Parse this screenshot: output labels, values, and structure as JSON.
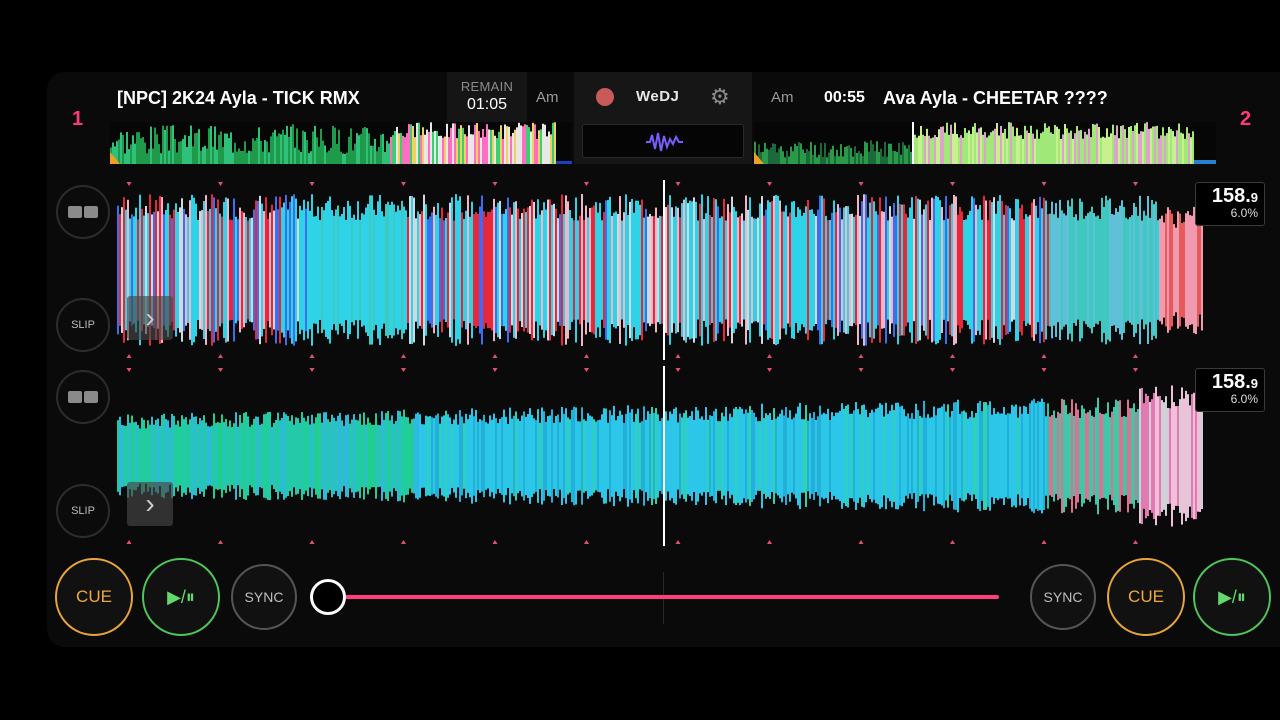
{
  "deck_left": {
    "number": "1",
    "title": "[NPC] 2K24 Ayla - TICK RMX",
    "remain_label": "REMAIN",
    "remain_time": "01:05",
    "key": "Am",
    "bpm_whole": "158.",
    "bpm_decimal": "9",
    "pitch": "6.0%",
    "slip_label": "SLIP",
    "cue_label": "CUE",
    "play_label": "▶/⏸",
    "sync_label": "SYNC"
  },
  "deck_right": {
    "number": "2",
    "title": "Ava Ayla - CHEETAR ????",
    "time": "00:55",
    "key": "Am",
    "bpm_whole": "158.",
    "bpm_decimal": "9",
    "pitch": "6.0%",
    "slip_label": "SLIP",
    "cue_label": "CUE",
    "play_label": "▶/⏸",
    "sync_label": "SYNC"
  },
  "center": {
    "logo": "WeDJ",
    "record_icon": "record-icon",
    "settings_icon": "gear-icon",
    "waveform_icon": "waveform-icon"
  },
  "colors": {
    "accent": "#ff3f7c",
    "cue": "#f0a93c",
    "play": "#62d96a",
    "deck_number": "#ff3a7c"
  },
  "crossfader": {
    "position": 0.0
  }
}
